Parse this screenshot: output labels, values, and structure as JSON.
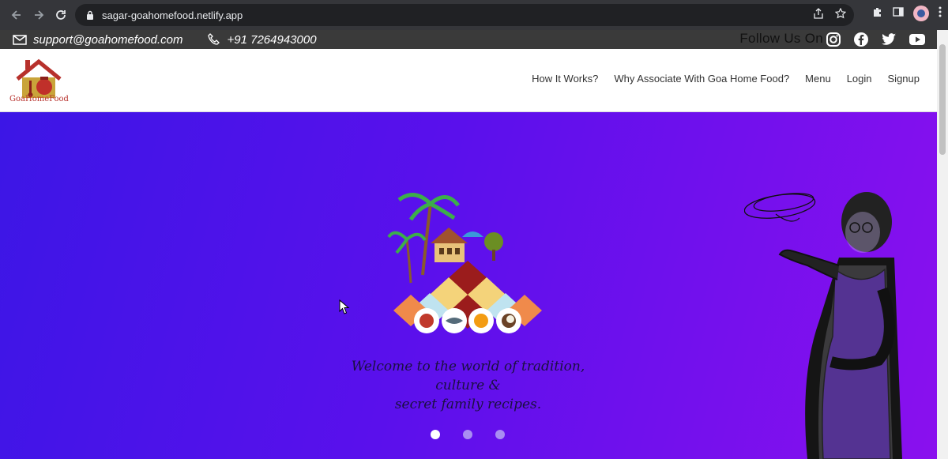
{
  "browser": {
    "url": "sagar-goahomefood.netlify.app"
  },
  "topbar": {
    "email": "support@goahomefood.com",
    "phone": "+91 7264943000",
    "follow_label": "Follow Us On",
    "socials": [
      "instagram-icon",
      "facebook-icon",
      "twitter-icon",
      "youtube-icon"
    ]
  },
  "header": {
    "logo_text": "GoaHomeFood",
    "menu": [
      {
        "label": "How It Works?"
      },
      {
        "label": "Why Associate With Goa Home Food?"
      },
      {
        "label": "Menu"
      },
      {
        "label": "Login"
      },
      {
        "label": "Signup"
      }
    ]
  },
  "hero": {
    "tagline_line1": "Welcome to the world of tradition,",
    "tagline_line2": "culture &",
    "tagline_line3": "secret family recipes.",
    "slide_count": 3,
    "active_slide": 1
  },
  "colors": {
    "hero_start": "#3c16e6",
    "hero_end": "#8a10ee",
    "topbar_bg": "#3a3a3a"
  }
}
